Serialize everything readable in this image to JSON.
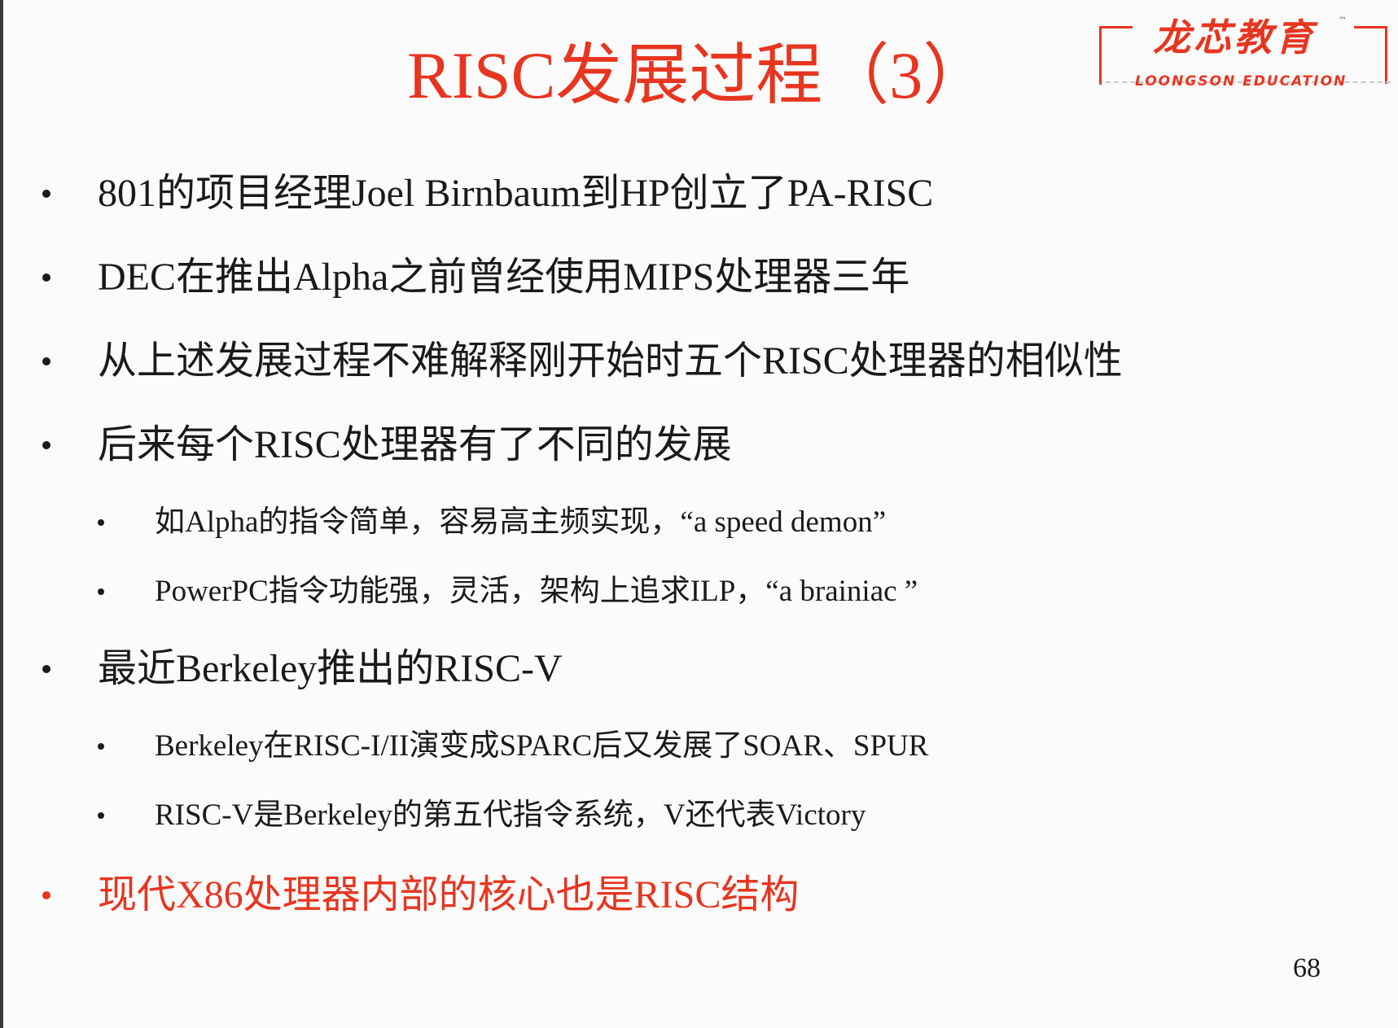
{
  "slide": {
    "title": "RISC发展过程（3）",
    "logo": {
      "cn": "龙芯教育",
      "tm": "™",
      "en": "LOONGSON EDUCATION"
    },
    "bullets": [
      {
        "level": 1,
        "text": "801的项目经理Joel Birnbaum到HP创立了PA-RISC",
        "color": "#1a1a1a"
      },
      {
        "level": 1,
        "text": "DEC在推出Alpha之前曾经使用MIPS处理器三年",
        "color": "#1a1a1a"
      },
      {
        "level": 1,
        "text": "从上述发展过程不难解释刚开始时五个RISC处理器的相似性",
        "color": "#1a1a1a"
      },
      {
        "level": 1,
        "text": "后来每个RISC处理器有了不同的发展",
        "color": "#1a1a1a"
      },
      {
        "level": 2,
        "text": "如Alpha的指令简单，容易高主频实现，“a speed demon”",
        "color": "#1a1a1a"
      },
      {
        "level": 2,
        "text": "PowerPC指令功能强，灵活，架构上追求ILP，“a brainiac ”",
        "color": "#1a1a1a"
      },
      {
        "level": 1,
        "text": "最近Berkeley推出的RISC-V",
        "color": "#1a1a1a"
      },
      {
        "level": 2,
        "text": "Berkeley在RISC-I/II演变成SPARC后又发展了SOAR、SPUR",
        "color": "#1a1a1a"
      },
      {
        "level": 2,
        "text": "RISC-V是Berkeley的第五代指令系统，V还代表Victory",
        "color": "#1a1a1a"
      },
      {
        "level": 1,
        "text": "现代X86处理器内部的核心也是RISC结构",
        "color": "#e8351f"
      }
    ],
    "page_number": "68",
    "accent_color": "#e8351f"
  }
}
